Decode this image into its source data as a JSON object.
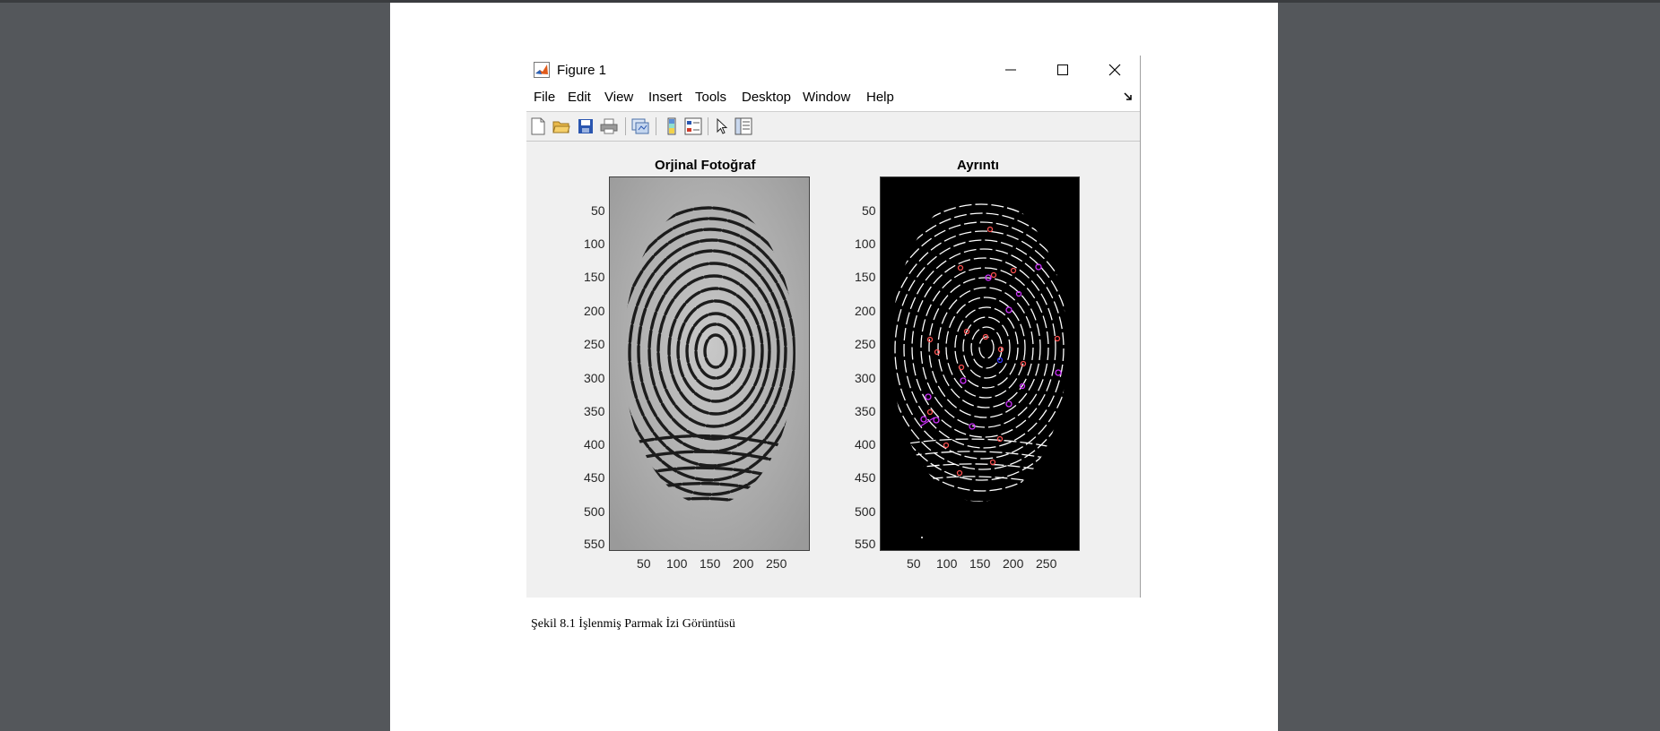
{
  "window": {
    "title": "Figure 1",
    "app_icon": "matlab-icon",
    "controls": [
      "minimize-icon",
      "maximize-icon",
      "close-icon"
    ]
  },
  "menu": [
    "File",
    "Edit",
    "View",
    "Insert",
    "Tools",
    "Desktop",
    "Window",
    "Help"
  ],
  "toolbar": [
    "new-figure-icon",
    "open-file-icon",
    "save-icon",
    "print-icon",
    "link-plot-icon",
    "insert-colorbar-icon",
    "insert-legend-icon",
    "edit-plot-arrow-icon",
    "property-inspector-icon"
  ],
  "axes": [
    {
      "title": "Orjinal Fotoğraf",
      "image": "grayscale fingerprint",
      "yticks": [
        "50",
        "100",
        "150",
        "200",
        "250",
        "300",
        "350",
        "400",
        "450",
        "500",
        "550"
      ],
      "xticks": [
        "50",
        "100",
        "150",
        "200",
        "250"
      ]
    },
    {
      "title": "Ayrıntı",
      "image": "thinned fingerprint with minutiae markers",
      "yticks": [
        "50",
        "100",
        "150",
        "200",
        "250",
        "300",
        "350",
        "400",
        "450",
        "500",
        "550"
      ],
      "xticks": [
        "50",
        "100",
        "150",
        "200",
        "250"
      ]
    }
  ],
  "colors": {
    "marker_red": "#ff5050",
    "marker_magenta": "#d030ff",
    "marker_blue": "#3030ff"
  },
  "caption": "Şekil 8.1 İşlenmiş Parmak İzi Görüntüsü"
}
